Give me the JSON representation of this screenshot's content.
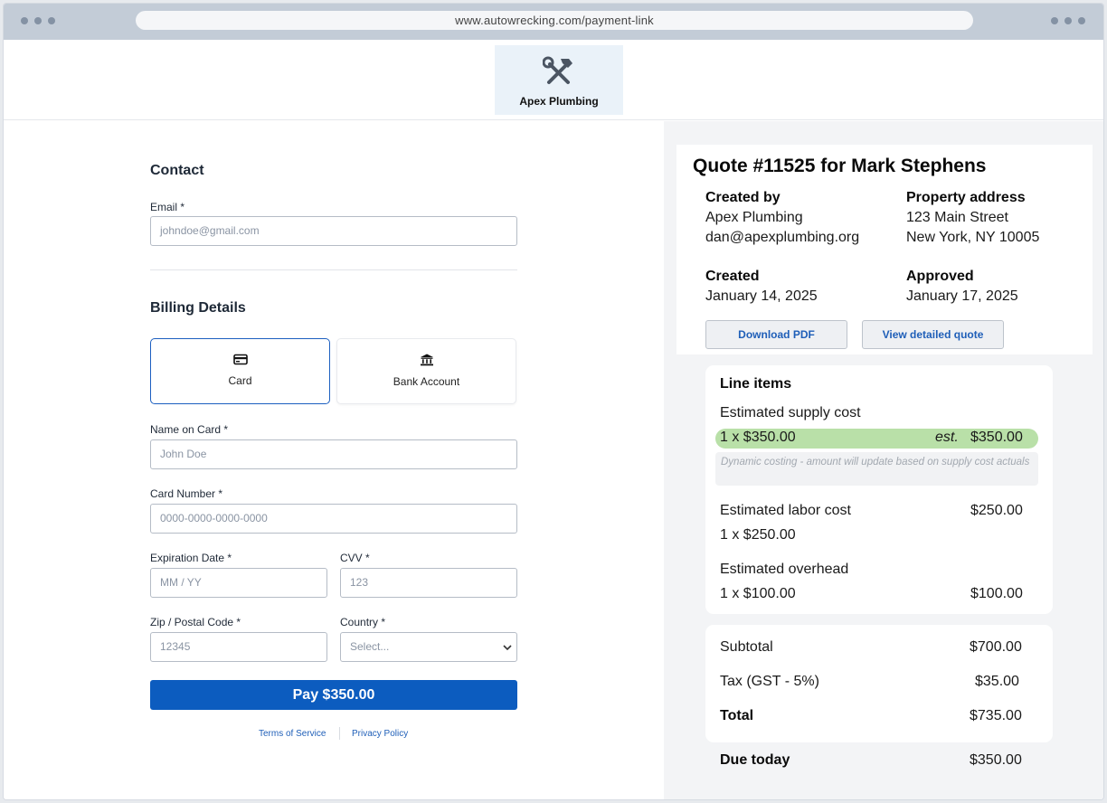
{
  "browser": {
    "url": "www.autowrecking.com/payment-link"
  },
  "brand": {
    "name": "Apex Plumbing",
    "icon": "tools-icon"
  },
  "contact": {
    "heading": "Contact",
    "email_label": "Email *",
    "email_placeholder": "johndoe@gmail.com"
  },
  "billing": {
    "heading": "Billing Details",
    "tabs": [
      {
        "label": "Card",
        "icon": "credit-card-icon",
        "selected": true
      },
      {
        "label": "Bank Account",
        "icon": "bank-icon",
        "selected": false
      }
    ],
    "name_label": "Name on Card *",
    "name_placeholder": "John Doe",
    "card_label": "Card Number *",
    "card_placeholder": "0000-0000-0000-0000",
    "exp_label": "Expiration Date *",
    "exp_placeholder": "MM / YY",
    "cvv_label": "CVV *",
    "cvv_placeholder": "123",
    "zip_label": "Zip / Postal Code *",
    "zip_placeholder": "12345",
    "country_label": "Country *",
    "country_placeholder": "Select...",
    "pay_label": "Pay $350.00"
  },
  "footer": {
    "terms": "Terms of Service",
    "privacy": "Privacy Policy"
  },
  "quote": {
    "title": "Quote #11525 for Mark Stephens",
    "created_by_label": "Created by",
    "created_by_name": "Apex Plumbing",
    "created_by_email": "dan@apexplumbing.org",
    "property_label": "Property address",
    "property_line1": "123 Main Street",
    "property_line2": "New York, NY 10005",
    "created_label": "Created",
    "created_date": "January 14, 2025",
    "approved_label": "Approved",
    "approved_date": "January 17, 2025",
    "download_label": "Download PDF",
    "view_label": "View detailed quote"
  },
  "line_items": {
    "heading": "Line items",
    "items": [
      {
        "name": "Estimated supply cost",
        "qty": "1 x $350.00",
        "est": "est.",
        "total": "$350.00",
        "note": "Dynamic costing - amount will update based on supply cost actuals"
      },
      {
        "name": "Estimated labor cost",
        "qty": "1 x $250.00",
        "total": "$250.00"
      },
      {
        "name": "Estimated overhead",
        "qty": "1 x $100.00",
        "total": "$100.00"
      }
    ]
  },
  "summary": {
    "subtotal_label": "Subtotal",
    "subtotal": "$700.00",
    "tax_label": "Tax (GST - 5%)",
    "tax": "$35.00",
    "total_label": "Total",
    "total": "$735.00",
    "due_label": "Due today",
    "due": "$350.00"
  },
  "colors": {
    "primary": "#0c5cbf",
    "link": "#1f5fb8",
    "highlight": "#b9e0a8",
    "logo_bg": "#eaf2f9"
  }
}
